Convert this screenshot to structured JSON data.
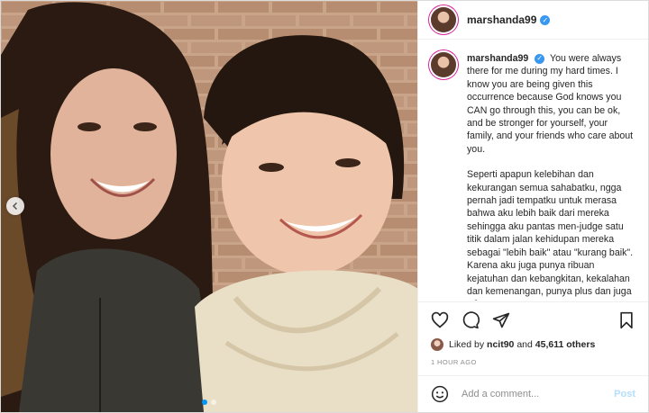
{
  "post": {
    "username": "marshanda99",
    "verified_icon": "verified-badge-icon",
    "caption": {
      "username": "marshanda99",
      "p1": "You were always there for me during my hard times. I know you are being given this occurrence because God knows you CAN go through this, you can be ok, and be stronger for yourself, your family, and your friends who care about you.",
      "p2": "Seperti apapun kelebihan dan kekurangan semua sahabatku, ngga pernah jadi tempatku untuk merasa bahwa aku lebih baik dari mereka sehingga aku pantas men-judge satu titik dalam jalan kehidupan mereka sebagai \"lebih baik\" atau \"kurang baik\". Karena aku juga punya ribuan kejatuhan dan kebangkitan, kekalahan dan kemenangan, punya plus dan juga minus."
    },
    "likes": {
      "prefix": "Liked by",
      "first_liker": "ncit90",
      "connector": "and",
      "others": "45,611 others"
    },
    "timestamp": "1 HOUR AGO",
    "comment": {
      "placeholder": "Add a comment...",
      "post_label": "Post"
    },
    "carousel": {
      "total": 2,
      "active": 1
    }
  },
  "colors": {
    "accent": "#0095f6",
    "verified": "#3897f0",
    "post_button": "#b2dffc",
    "muted": "#8e8e8e"
  },
  "icons": [
    "heart-icon",
    "comment-icon",
    "share-icon",
    "bookmark-icon",
    "emoji-icon",
    "chevron-left-icon"
  ]
}
